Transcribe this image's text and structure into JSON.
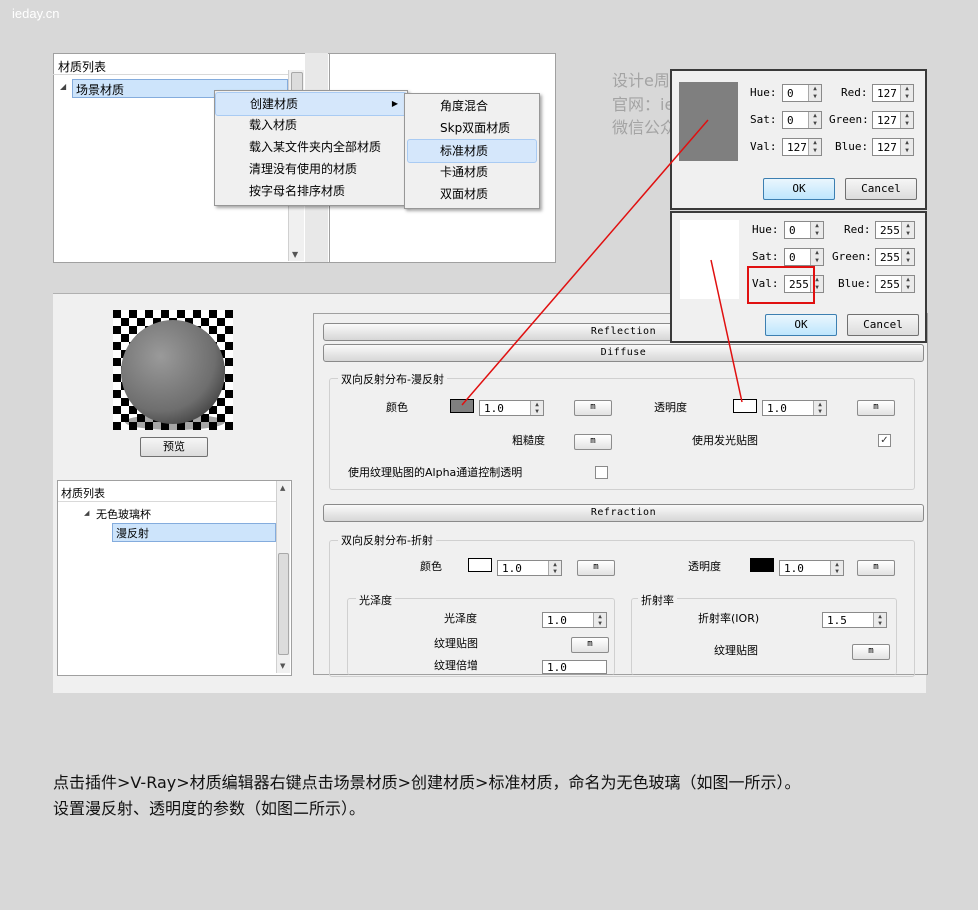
{
  "watermark_top": "ieday.cn",
  "watermark": [
    "设计e周网 发现与共享视觉创意和灵感",
    "官网：ieday.cn",
    "微信公众号：iedaycn"
  ],
  "panel1": {
    "list_header": "材质列表",
    "tree_root": "场景材质",
    "context_menu": [
      "创建材质",
      "载入材质",
      "载入某文件夹内全部材质",
      "清理没有使用的材质",
      "按字母名排序材质"
    ],
    "submenu_arrow": "▶",
    "submenu": [
      "角度混合",
      "Skp双面材质",
      "标准材质",
      "卡通材质",
      "双面材质"
    ]
  },
  "dialog1": {
    "hue_label": "Hue:",
    "hue": "0",
    "sat_label": "Sat:",
    "sat": "0",
    "val_label": "Val:",
    "val": "127",
    "red_label": "Red:",
    "red": "127",
    "green_label": "Green:",
    "green": "127",
    "blue_label": "Blue:",
    "blue": "127",
    "ok": "OK",
    "cancel": "Cancel",
    "swatch_color": "#7f7f7f"
  },
  "dialog2": {
    "hue_label": "Hue:",
    "hue": "0",
    "sat_label": "Sat:",
    "sat": "0",
    "val_label": "Val:",
    "val": "255",
    "red_label": "Red:",
    "red": "255",
    "green_label": "Green:",
    "green": "255",
    "blue_label": "Blue:",
    "blue": "255",
    "ok": "OK",
    "cancel": "Cancel",
    "swatch_color": "#ffffff"
  },
  "editor": {
    "preview_button": "预览",
    "list_header": "材质列表",
    "tree_root": "无色玻璃杯",
    "tree_child": "漫反射",
    "reflection_bar": "Reflection",
    "diffuse_bar": "Diffuse",
    "diffuse_group": "双向反射分布-漫反射",
    "color_label": "颜色",
    "color_value": "1.0",
    "transparency_label": "透明度",
    "transparency_value": "1.0",
    "roughness_label": "粗糙度",
    "use_emissive_label": "使用发光贴图",
    "alpha_label": "使用纹理贴图的Alpha通道控制透明",
    "m": "m",
    "refraction_bar": "Refraction",
    "refraction_group": "双向反射分布-折射",
    "r_color_label": "颜色",
    "r_color_value": "1.0",
    "r_transparency_label": "透明度",
    "r_transparency_value": "1.0",
    "gloss_group": "光泽度",
    "gloss_label": "光泽度",
    "gloss_value": "1.0",
    "tex_map_label": "纹理贴图",
    "tex_mult_label": "纹理倍增",
    "tex_mult_value": "1.0",
    "ior_group": "折射率",
    "ior_label": "折射率(IOR)",
    "ior_value": "1.5",
    "ior_tex_label": "纹理贴图",
    "check_mark": "✓"
  },
  "colors": {
    "annotation": "#e01010",
    "diffuse_swatch": "#7f7f7f",
    "transparency_swatch": "#ffffff",
    "refraction_transparency_swatch": "#000000"
  },
  "caption": [
    "点击插件>V-Ray>材质编辑器右键点击场景材质>创建材质>标准材质，命名为无色玻璃（如图一所示）。",
    "设置漫反射、透明度的参数（如图二所示）。"
  ]
}
